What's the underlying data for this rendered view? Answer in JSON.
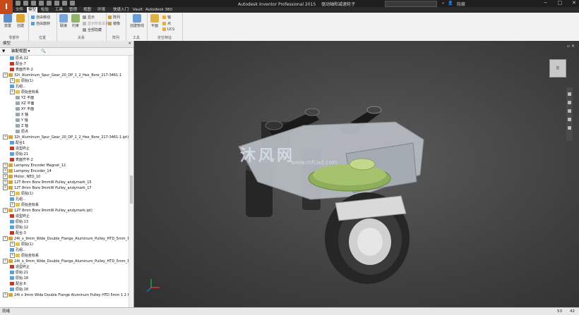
{
  "app_button": "I",
  "window_title": "Autodesk Inventor Professional 2015",
  "document_name": "驱动轴和减速轮子",
  "user_name": "隐藏",
  "ribbon_tabs": [
    "文件",
    "模型",
    "检验",
    "工具",
    "管理",
    "视图",
    "环境",
    "快速入门",
    "Vault",
    "Autodesk 360"
  ],
  "ribbon": {
    "groups": [
      {
        "label": "零部件",
        "buttons": [
          "放置",
          "创建"
        ]
      },
      {
        "label": "位置",
        "buttons": [
          "自由移动",
          "自由旋转"
        ]
      },
      {
        "label": "关系",
        "buttons": [
          "联接",
          "约束",
          "显示",
          "显示所有关系",
          "全部隐藏"
        ]
      },
      {
        "label": "阵列",
        "buttons": [
          "阵列",
          "镜像"
        ]
      },
      {
        "label": "工具",
        "buttons": [
          "创建管线"
        ]
      },
      {
        "label": "定位特征",
        "buttons": [
          "平面",
          "轴",
          "点",
          "UCS"
        ]
      }
    ]
  },
  "browser": {
    "title": "模型",
    "toolbar_label": "装配视图",
    "rows": [
      {
        "t": "原点:22",
        "k": "c"
      },
      {
        "t": "配合:7",
        "k": "g"
      },
      {
        "t": "表面齐平:2",
        "k": "g"
      },
      {
        "t": "32t_Aluminum_Spur_Gear_20_DP_1_2_Hex_Bore_217-3461:1",
        "k": "p"
      },
      {
        "t": "原始(1)",
        "k": "o"
      },
      {
        "t": "孔组...",
        "k": "c"
      },
      {
        "t": "原始坐标系",
        "k": "o"
      },
      {
        "t": "YZ 平面",
        "k": "f"
      },
      {
        "t": "XZ 平面",
        "k": "f"
      },
      {
        "t": "XY 平面",
        "k": "f"
      },
      {
        "t": "X 轴",
        "k": "f"
      },
      {
        "t": "Y 轴",
        "k": "f"
      },
      {
        "t": "Z 轴",
        "k": "f"
      },
      {
        "t": "原点",
        "k": "f"
      },
      {
        "t": "32t_Aluminum_Spur_Gear_20_DP_1_2_Hex_Bore_217-3461:1.ipt)",
        "k": "p"
      },
      {
        "t": "配合1",
        "k": "c"
      },
      {
        "t": "造型终止",
        "k": "r"
      },
      {
        "t": "原始:21",
        "k": "c"
      },
      {
        "t": "表面齐平:2",
        "k": "g"
      },
      {
        "t": "Lamprey Encoder Magnet_12",
        "k": "p"
      },
      {
        "t": "Lamprey Encoder_14",
        "k": "p"
      },
      {
        "t": "Motor, NEO_10",
        "k": "p"
      },
      {
        "t": "12T 8mm Bore 9mmW Pulley_andymark_15",
        "k": "p"
      },
      {
        "t": "12T 8mm Bore 9mmW Pulley_andymark_17",
        "k": "p"
      },
      {
        "t": "原始(1)",
        "k": "o"
      },
      {
        "t": "孔组...",
        "k": "c"
      },
      {
        "t": "原始坐标系",
        "k": "o"
      },
      {
        "t": "12T 8mm Bore 9mmW Pulley_andymark.ipt)",
        "k": "p"
      },
      {
        "t": "造型终止",
        "k": "r"
      },
      {
        "t": "原始:13",
        "k": "c"
      },
      {
        "t": "原始:12",
        "k": "c"
      },
      {
        "t": "配合:3",
        "k": "g"
      },
      {
        "t": "24t_x_9mm_Wide_Double_Flange_Aluminum_Pulley_HTD_5mm_1_2_Hex_Bo",
        "k": "p"
      },
      {
        "t": "原始(1)",
        "k": "o"
      },
      {
        "t": "孔组...",
        "k": "c"
      },
      {
        "t": "原始坐标系",
        "k": "o"
      },
      {
        "t": "24t_x_9mm_Wide_Double_Flange_Aluminum_Pulley_HTD_5mm_1_2_Hex",
        "k": "p"
      },
      {
        "t": "造型终止",
        "k": "r"
      },
      {
        "t": "原始:21",
        "k": "c"
      },
      {
        "t": "原始:18",
        "k": "c"
      },
      {
        "t": "配合:6",
        "k": "g"
      },
      {
        "t": "原始:18",
        "k": "c"
      },
      {
        "t": "24t x 9mm Wide Double Flange Aluminum Pulley HTD 5mm 1 2 Hex Bo",
        "k": "p"
      }
    ]
  },
  "viewcube_label": "前",
  "watermark": "沐风网",
  "watermark_url": "www.mfcad.com",
  "status": {
    "ready": "就绪",
    "count1": "53",
    "count2": "42"
  }
}
